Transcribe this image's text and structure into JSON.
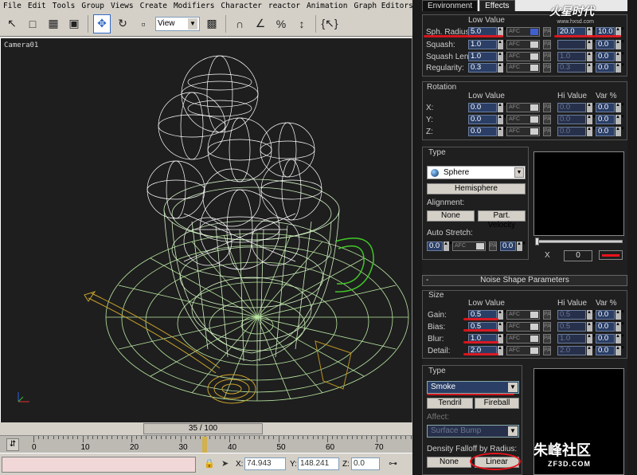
{
  "menu": [
    "File",
    "Edit",
    "Tools",
    "Group",
    "Views",
    "Create",
    "Modifiers",
    "Character",
    "reactor",
    "Animation",
    "Graph Editors",
    "Rende"
  ],
  "toolbar": {
    "view_select": "View",
    "icons": [
      "select-arrow-icon",
      "select-region-icon",
      "select-by-name-icon",
      "window-crossing-icon",
      "move-icon",
      "rotate-icon",
      "scale-icon",
      "pivot-icon",
      "snap-icon",
      "angle-snap-icon",
      "percent-snap-icon",
      "spinner-snap-icon",
      "named-selection-icon"
    ]
  },
  "viewport": {
    "label": "Camera01"
  },
  "timeline": {
    "frame_display": "35 / 100",
    "ticks": [
      "0",
      "10",
      "20",
      "30",
      "40",
      "50",
      "60",
      "70"
    ],
    "current_frame": 35,
    "total_frames": 100
  },
  "status": {
    "x_label": "X:",
    "x_value": "74.943",
    "y_label": "Y:",
    "y_value": "148.241",
    "z_label": "Z:",
    "z_value": "0.0"
  },
  "panel": {
    "tabs": [
      "Environment",
      "Effects"
    ],
    "shape_section": {
      "low_value_header": "Low Value",
      "rows": [
        {
          "label": "Sph. Radius:",
          "low": "5.0",
          "hi": "20.0",
          "var": "10.0",
          "hi_dim": false
        },
        {
          "label": "Squash:",
          "low": "1.0",
          "hi": "",
          "var": "0.0",
          "hi_dim": true
        },
        {
          "label": "Squash Len:",
          "low": "1.0",
          "hi": "1.0",
          "var": "0.0",
          "hi_dim": true
        },
        {
          "label": "Regularity:",
          "low": "0.3",
          "hi": "0.3",
          "var": "0.0",
          "hi_dim": true
        }
      ]
    },
    "rotation": {
      "title": "Rotation",
      "low_header": "Low Value",
      "hi_header": "Hi Value",
      "var_header": "Var %",
      "rows": [
        {
          "label": "X:",
          "low": "0.0",
          "hi": "0.0",
          "var": "0.0"
        },
        {
          "label": "Y:",
          "low": "0.0",
          "hi": "0.0",
          "var": "0.0"
        },
        {
          "label": "Z:",
          "low": "0.0",
          "hi": "0.0",
          "var": "0.0"
        }
      ]
    },
    "type": {
      "title": "Type",
      "selected": "Sphere",
      "hemisphere_btn": "Hemisphere",
      "alignment_label": "Alignment:",
      "none_btn": "None",
      "part_velocity_btn": "Part. Velocity",
      "auto_stretch_label": "Auto Stretch:",
      "auto_stretch_value": "0.0",
      "auto_stretch_pa": "0.0",
      "x_btn": "X",
      "zero_value": "0"
    },
    "noise_rollout": {
      "title": "Noise Shape Parameters",
      "minus": "-"
    },
    "size": {
      "title": "Size",
      "low_header": "Low Value",
      "hi_header": "Hi Value",
      "var_header": "Var %",
      "rows": [
        {
          "label": "Gain:",
          "low": "0.5",
          "hi": "0.5",
          "var": "0.0"
        },
        {
          "label": "Bias:",
          "low": "0.5",
          "hi": "0.5",
          "var": "0.0"
        },
        {
          "label": "Blur:",
          "low": "1.0",
          "hi": "1.0",
          "var": "0.0"
        },
        {
          "label": "Detail:",
          "low": "2.0",
          "hi": "2.0",
          "var": "0.0"
        }
      ]
    },
    "noise_type": {
      "title": "Type",
      "selected": "Smoke",
      "tendril_btn": "Tendril",
      "fireball_btn": "Fireball",
      "affect_label": "Affect:",
      "affect_value": "Surface Bump",
      "density_label": "Density Falloff by Radius:",
      "none_btn": "None",
      "linear_btn": "Linear"
    }
  },
  "watermarks": {
    "top": "火星时代",
    "top_sub": "www.hxsd.com",
    "bottom": "朱峰社区",
    "bottom_sub": "ZF3D.COM"
  },
  "colors": {
    "viewport_bg": "#1e1e1e",
    "highlight_red": "#e8141c",
    "spinner_blue": "#2a3e66"
  }
}
